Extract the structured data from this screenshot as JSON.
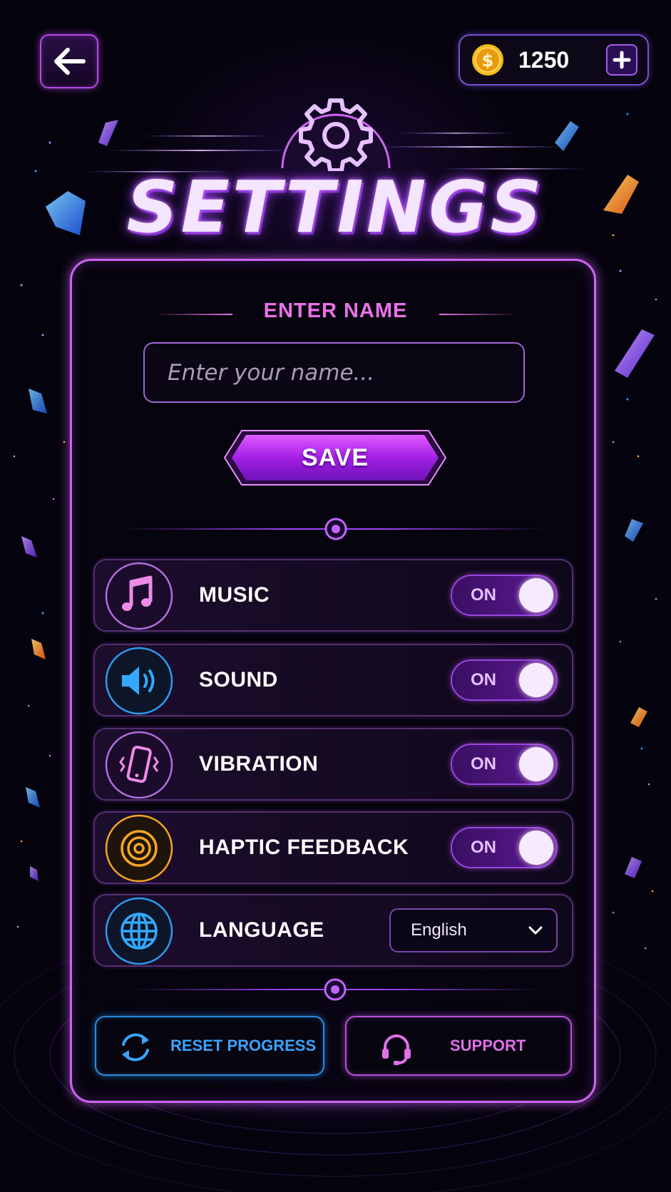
{
  "header": {
    "coins": "1250"
  },
  "title": "SETTINGS",
  "name_section": {
    "heading": "ENTER NAME",
    "placeholder": "Enter your name...",
    "save_label": "SAVE"
  },
  "settings": [
    {
      "label": "MUSIC",
      "icon": "music-note-icon",
      "state": "ON",
      "color": "#e27ae8"
    },
    {
      "label": "SOUND",
      "icon": "speaker-icon",
      "state": "ON",
      "color": "#2d9cf0"
    },
    {
      "label": "VIBRATION",
      "icon": "phone-vibrate-icon",
      "state": "ON",
      "color": "#d069e8"
    },
    {
      "label": "HAPTIC FEEDBACK",
      "icon": "haptic-rings-icon",
      "state": "ON",
      "color": "#f5a623"
    },
    {
      "label": "LANGUAGE",
      "icon": "globe-icon",
      "value": "English",
      "color": "#2d9cf0"
    }
  ],
  "bottom_buttons": {
    "reset": "RESET PROGRESS",
    "support": "SUPPORT"
  },
  "colors": {
    "accent_purple": "#cf64f2",
    "accent_pink": "#ea72e8",
    "accent_blue": "#2a8cdc",
    "coin_gold": "#f5b91c",
    "background": "#05030d"
  }
}
